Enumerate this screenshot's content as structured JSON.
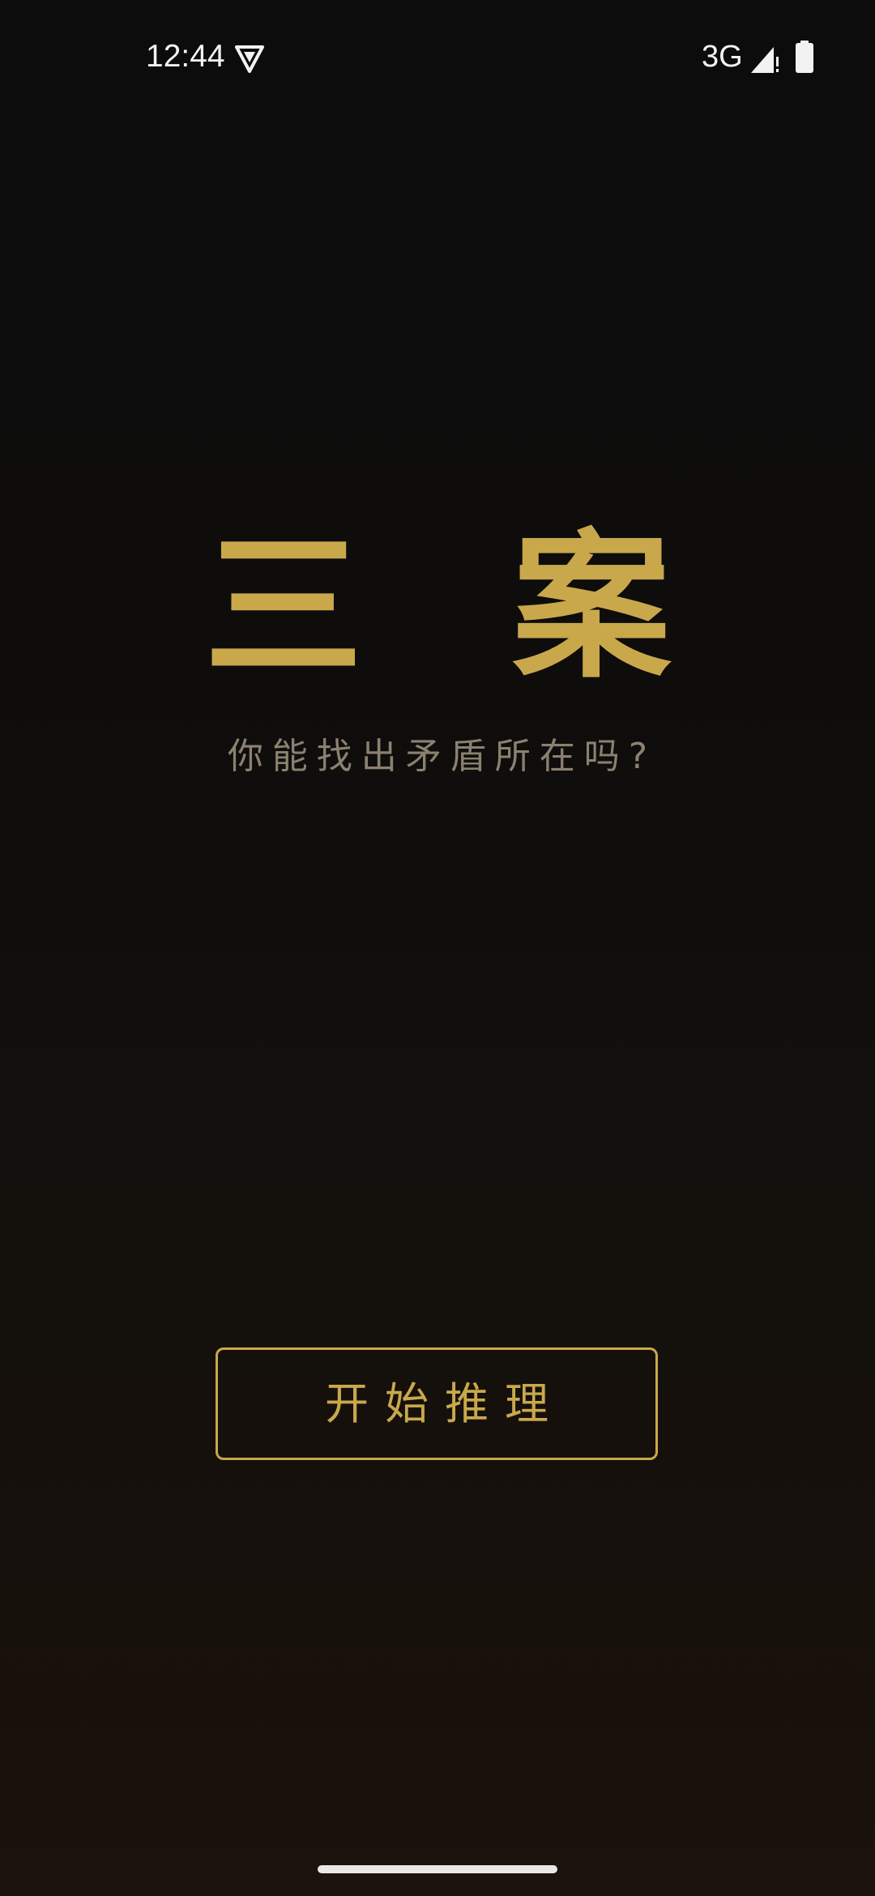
{
  "status_bar": {
    "time": "12:44",
    "network": "3G",
    "icons": [
      "vpn-shield-icon",
      "cell-signal-icon",
      "battery-icon"
    ]
  },
  "main": {
    "title": "三 案",
    "subtitle": "你能找出矛盾所在吗?"
  },
  "actions": {
    "start_label": "开始推理"
  },
  "colors": {
    "accent": "#c9a84c",
    "subtitle": "#8b8170",
    "background_top": "#0c0c0c",
    "background_bottom": "#1a120b"
  }
}
